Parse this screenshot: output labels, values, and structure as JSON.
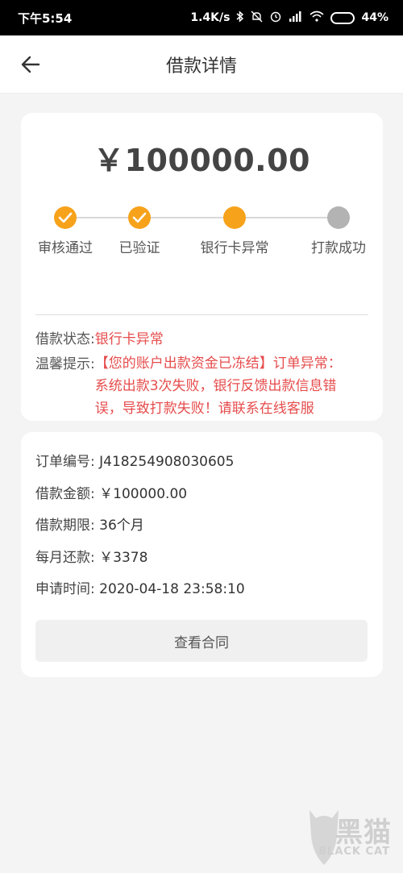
{
  "status_bar": {
    "time": "下午5:54",
    "network_speed": "1.4K/s",
    "battery": "44%",
    "battery_level": 0.44,
    "icons": [
      "bluetooth-icon",
      "mute-icon",
      "alarm-icon",
      "hd-signal-icon",
      "wifi-icon",
      "battery-icon"
    ]
  },
  "nav": {
    "title": "借款详情",
    "back_icon": "arrow-left-icon"
  },
  "loan": {
    "amount": "￥100000.00",
    "steps": [
      {
        "label": "审核通过",
        "state": "done"
      },
      {
        "label": "已验证",
        "state": "done"
      },
      {
        "label": "银行卡异常",
        "state": "current"
      },
      {
        "label": "打款成功",
        "state": "pending"
      }
    ],
    "status_label": "借款状态:",
    "status_value": "银行卡异常",
    "tip_label": "温馨提示:",
    "tip_text": "【您的账户出款资金已冻结】订单异常：系统出款3次失败，银行反馈出款信息错误，导致打款失败！请联系在线客服"
  },
  "details": {
    "order_no_label": "订单编号:",
    "order_no": "J418254908030605",
    "amount_label": "借款金额:",
    "amount": "￥100000.00",
    "term_label": "借款期限:",
    "term": "36个月",
    "monthly_label": "每月还款:",
    "monthly": "￥3378",
    "time_label": "申请时间:",
    "time": "2020-04-18 23:58:10",
    "contract_button": "查看合同"
  },
  "watermark": {
    "cn": "黑猫",
    "en": "BLACK CAT"
  },
  "colors": {
    "accent": "#f7a21b",
    "pending": "#b3b3b3",
    "alert": "#e64c4c"
  }
}
